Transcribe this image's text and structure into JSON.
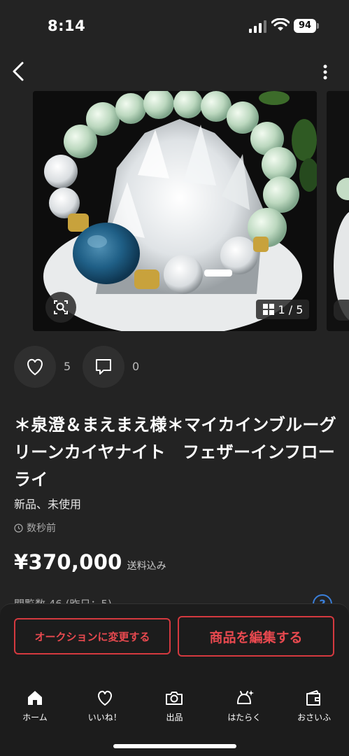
{
  "status_bar": {
    "time": "8:14",
    "battery": "94"
  },
  "carousel": {
    "page": "1 / 5"
  },
  "actions": {
    "like_count": "5",
    "comment_count": "0"
  },
  "product": {
    "title": "＊泉澄＆まえまえ様＊マイカインブルーグリーンカイヤナイト　フェザーインフローライ",
    "condition": "新品、未使用",
    "posted": "数秒前",
    "price": "¥370,000",
    "shipping": "送料込み",
    "views_partial": "閲覧数 46 (昨日：5)"
  },
  "buttons": {
    "auction": "オークションに変更する",
    "edit": "商品を編集する"
  },
  "tabs": [
    {
      "label": "ホーム",
      "icon": "home-icon"
    },
    {
      "label": "いいね！",
      "icon": "heart-icon"
    },
    {
      "label": "出品",
      "icon": "camera-icon"
    },
    {
      "label": "はたらく",
      "icon": "bell-sparkle-icon"
    },
    {
      "label": "おさいふ",
      "icon": "wallet-icon"
    }
  ],
  "colors": {
    "accent": "#d4393f",
    "background": "#232323",
    "help": "#3a7fd9"
  }
}
